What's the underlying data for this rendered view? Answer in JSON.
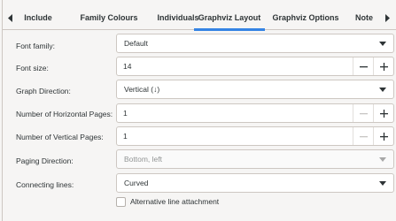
{
  "tabs": [
    {
      "label": "Include"
    },
    {
      "label": "Family Colours"
    },
    {
      "label": "Individuals"
    },
    {
      "label": "Graphviz Layout"
    },
    {
      "label": "Graphviz Options"
    },
    {
      "label": "Note"
    }
  ],
  "active_tab": "Graphviz Layout",
  "fields": {
    "font_family": {
      "label": "Font family:",
      "value": "Default"
    },
    "font_size": {
      "label": "Font size:",
      "value": "14"
    },
    "graph_direction": {
      "label": "Graph Direction:",
      "value": "Vertical (↓)"
    },
    "h_pages": {
      "label": "Number of Horizontal Pages:",
      "value": "1"
    },
    "v_pages": {
      "label": "Number of Vertical Pages:",
      "value": "1"
    },
    "paging_direction": {
      "label": "Paging Direction:",
      "value": "Bottom, left"
    },
    "connecting_lines": {
      "label": "Connecting lines:",
      "value": "Curved"
    }
  },
  "alt_line_attachment": {
    "label": "Alternative line attachment",
    "checked": false
  },
  "colors": {
    "accent": "#3584e4",
    "border": "#cdc7c2",
    "text": "#2e3436",
    "disabled_text": "#929595"
  }
}
